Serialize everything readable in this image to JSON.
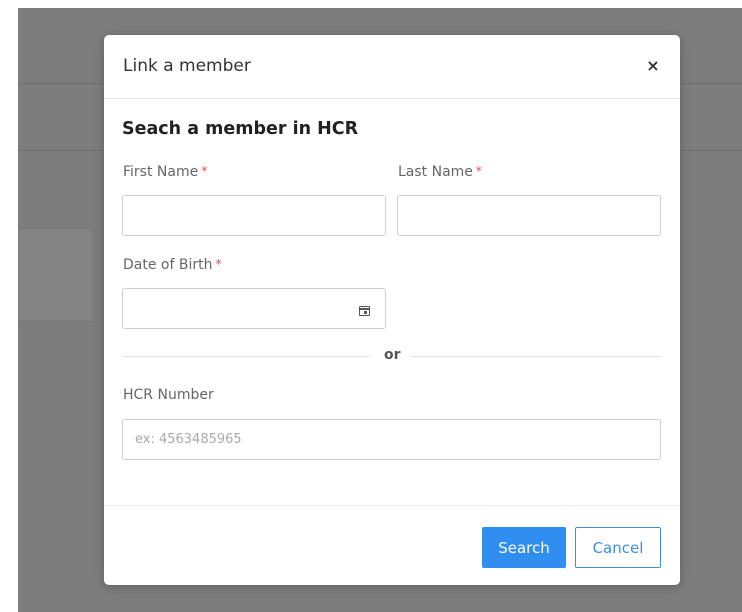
{
  "modal": {
    "title": "Link a member",
    "close_glyph": "×",
    "section_title": "Seach a member in HCR",
    "first_name": {
      "label": "First Name",
      "required_mark": "*",
      "value": ""
    },
    "last_name": {
      "label": "Last Name",
      "required_mark": "*",
      "value": ""
    },
    "dob": {
      "label": "Date of Birth",
      "required_mark": "*",
      "value": ""
    },
    "divider_text": "or",
    "hcr": {
      "label": "HCR Number",
      "placeholder": "ex: 4563485965",
      "value": ""
    },
    "buttons": {
      "search": "Search",
      "cancel": "Cancel"
    }
  },
  "colors": {
    "overlay": "#7d7d7d",
    "primary": "#2f8ef0",
    "required": "#d9534f"
  },
  "icons": {
    "date_picker": "calendar-icon",
    "close": "close-icon"
  }
}
